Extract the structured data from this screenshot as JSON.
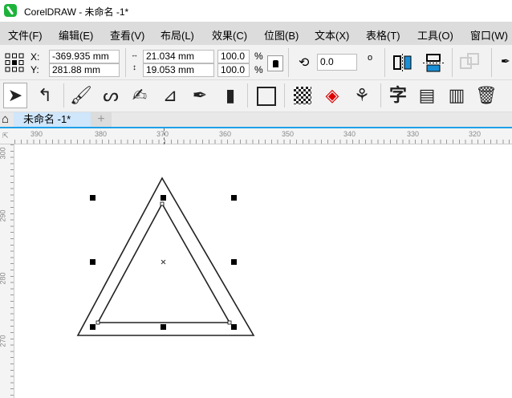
{
  "titlebar": {
    "title": "CorelDRAW - 未命名 -1*"
  },
  "menu": [
    "文件(F)",
    "编辑(E)",
    "查看(V)",
    "布局(L)",
    "效果(C)",
    "位图(B)",
    "文本(X)",
    "表格(T)",
    "工具(O)",
    "窗口(W)"
  ],
  "props": {
    "x_label": "X:",
    "y_label": "Y:",
    "x": "-369.935 mm",
    "y": "281.88 mm",
    "width": "21.034 mm",
    "height": "19.053 mm",
    "scale_x": "100.0",
    "scale_y": "100.0",
    "pct": "%",
    "rotation": "0.0",
    "degree": "o"
  },
  "tabs": {
    "document": "未命名 -1*",
    "add": "+"
  },
  "ruler_h": [
    "390",
    "380",
    "370",
    "360",
    "350",
    "340",
    "330",
    "320"
  ],
  "ruler_v": [
    "300",
    "290",
    "280",
    "270"
  ]
}
